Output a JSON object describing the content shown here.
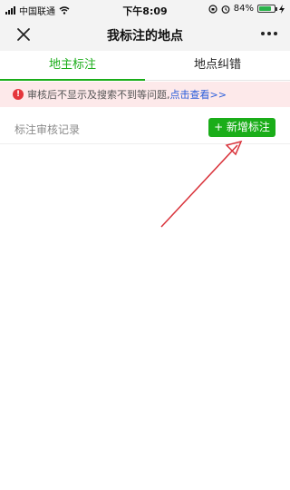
{
  "status_bar": {
    "carrier": "中国联通",
    "time": "下午8:09",
    "battery_percent": "84%",
    "battery_level": 0.84,
    "icons": [
      "signal-icon",
      "wifi-icon",
      "lock-rotation-icon",
      "alarm-icon",
      "battery-icon",
      "charging-icon"
    ]
  },
  "nav": {
    "title": "我标注的地点",
    "icons": [
      "close-icon",
      "more-icon"
    ]
  },
  "tabs": [
    {
      "label": "地主标注",
      "active": true
    },
    {
      "label": "地点纠错",
      "active": false
    }
  ],
  "notice": {
    "icon": "exclamation-icon",
    "text": "审核后不显示及搜索不到等问题,",
    "link": "点击查看>>"
  },
  "records": {
    "label": "标注审核记录",
    "add_button": "+ 新增标注"
  },
  "colors": {
    "accent": "#1aad19",
    "notice_bg": "#fde9ea",
    "notice_icon": "#e5363c",
    "link": "#2a5ddb",
    "annotation_arrow": "#d9323a"
  }
}
